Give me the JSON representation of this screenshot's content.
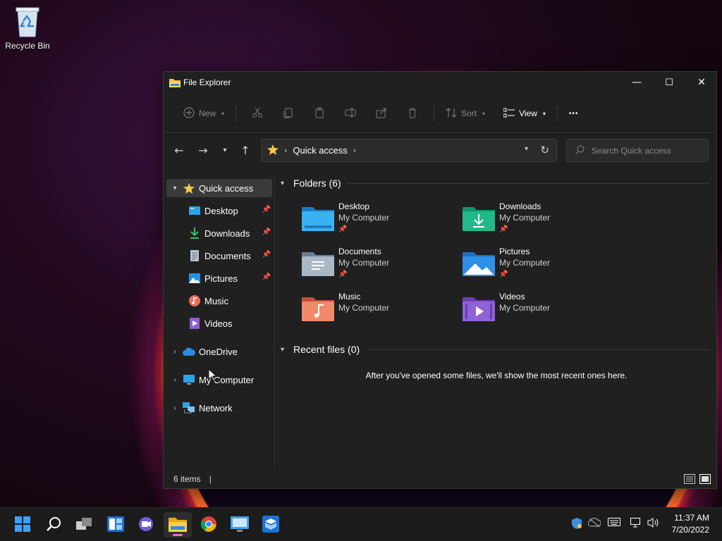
{
  "desktop": {
    "recycle_bin_label": "Recycle Bin"
  },
  "window": {
    "title": "File Explorer",
    "controls": {
      "minimize": "—",
      "maximize": "☐",
      "close": "✕"
    }
  },
  "toolbar": {
    "new_label": "New",
    "sort_label": "Sort",
    "view_label": "View",
    "more_label": "•••"
  },
  "address": {
    "crumb": "Quick access",
    "search_placeholder": "Search Quick access"
  },
  "sidebar": {
    "quick_access": "Quick access",
    "items": [
      {
        "label": "Desktop",
        "pinned": true
      },
      {
        "label": "Downloads",
        "pinned": true
      },
      {
        "label": "Documents",
        "pinned": true
      },
      {
        "label": "Pictures",
        "pinned": true
      },
      {
        "label": "Music",
        "pinned": false
      },
      {
        "label": "Videos",
        "pinned": false
      }
    ],
    "onedrive": "OneDrive",
    "my_computer": "My Computer",
    "network": "Network"
  },
  "content": {
    "folders_header": "Folders (6)",
    "folders": [
      {
        "name": "Desktop",
        "location": "My Computer",
        "pinned": true
      },
      {
        "name": "Downloads",
        "location": "My Computer",
        "pinned": true
      },
      {
        "name": "Documents",
        "location": "My Computer",
        "pinned": true
      },
      {
        "name": "Pictures",
        "location": "My Computer",
        "pinned": true
      },
      {
        "name": "Music",
        "location": "My Computer",
        "pinned": false
      },
      {
        "name": "Videos",
        "location": "My Computer",
        "pinned": false
      }
    ],
    "recent_header": "Recent files (0)",
    "recent_empty": "After you've opened some files, we'll show the most recent ones here."
  },
  "status": {
    "item_count": "6 items",
    "caret": "|"
  },
  "taskbar": {
    "time": "11:37 AM",
    "date": "7/20/2022"
  },
  "colors": {
    "accent": "#60cdff",
    "window_bg": "#202020",
    "taskbar_bg": "#1c1c1c",
    "active_indicator": "#e56ec6"
  }
}
